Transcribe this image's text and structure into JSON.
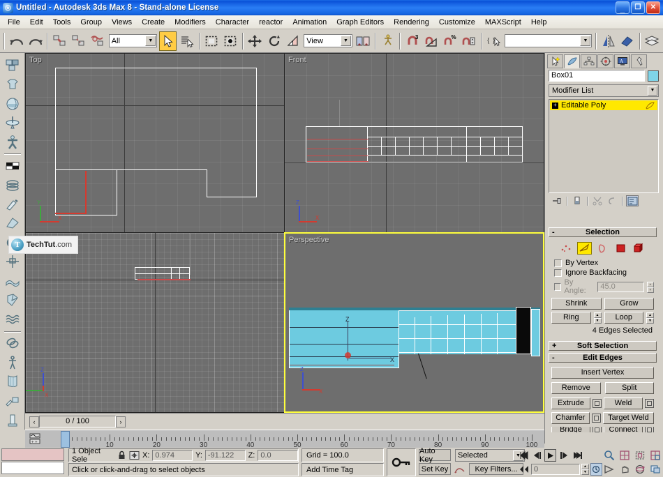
{
  "window": {
    "title": "Untitled - Autodesk 3ds Max 8  - Stand-alone License",
    "app_icon": "3dsmax-icon",
    "minimize_label": "_",
    "restore_label": "❐",
    "close_label": "✕"
  },
  "menubar": {
    "items": [
      {
        "label": "File"
      },
      {
        "label": "Edit"
      },
      {
        "label": "Tools"
      },
      {
        "label": "Group"
      },
      {
        "label": "Views"
      },
      {
        "label": "Create"
      },
      {
        "label": "Modifiers"
      },
      {
        "label": "Character"
      },
      {
        "label": "reactor"
      },
      {
        "label": "Animation"
      },
      {
        "label": "Graph Editors"
      },
      {
        "label": "Rendering"
      },
      {
        "label": "Customize"
      },
      {
        "label": "MAXScript"
      },
      {
        "label": "Help"
      }
    ]
  },
  "toolbar": {
    "undo_icon": "undo-icon",
    "redo_icon": "redo-icon",
    "select_link_icon": "select-and-link-icon",
    "unlink_icon": "unlink-selection-icon",
    "bind_space_warp_icon": "bind-to-space-warp-icon",
    "selection_filter_value": "All",
    "select_object_icon": "select-object-icon",
    "select_by_name_icon": "select-by-name-icon",
    "region_select_icon": "rectangular-selection-region-icon",
    "window_crossing_icon": "window-crossing-icon",
    "select_move_icon": "select-and-move-icon",
    "select_rotate_icon": "select-and-rotate-icon",
    "select_scale_icon": "select-and-uniform-scale-icon",
    "coord_system_value": "View",
    "use_pivot_icon": "use-pivot-point-center-icon",
    "manipulate_icon": "select-and-manipulate-icon",
    "snap_toggle_label": "3",
    "snap_toggle_icon": "snaps-toggle-icon",
    "angle_snap_icon": "angle-snap-toggle-icon",
    "percent_snap_label": "%",
    "percent_snap_icon": "percent-snap-toggle-icon",
    "spinner_snap_icon": "spinner-snap-toggle-icon",
    "named_selection_icon": "named-selection-sets-icon",
    "named_selection_value": "",
    "mirror_icon": "mirror-icon",
    "align_icon": "align-icon",
    "layer_manager_icon": "layer-manager-icon"
  },
  "left_toolbar": {
    "items": [
      {
        "icon": "boxes-icon"
      },
      {
        "icon": "garment-icon"
      },
      {
        "icon": "sphere-icon"
      },
      {
        "icon": "spinning-top-icon"
      },
      {
        "icon": "biped-icon"
      },
      {
        "icon": "checker-icon"
      },
      {
        "icon": "coil-icon"
      },
      {
        "icon": "knife-icon"
      },
      {
        "icon": "wedge-icon"
      },
      {
        "icon": "gear-icon"
      },
      {
        "icon": "compass-icon"
      },
      {
        "icon": "cloth-icon"
      },
      {
        "icon": "fold-icon"
      },
      {
        "icon": "wave-icon"
      },
      {
        "icon": "torus-knot-icon"
      },
      {
        "icon": "skeleton-icon"
      },
      {
        "icon": "curved-surface-icon"
      },
      {
        "icon": "paint-icon"
      },
      {
        "icon": "column-icon"
      }
    ]
  },
  "viewports": [
    {
      "name": "top",
      "label": "Top",
      "active": false
    },
    {
      "name": "front",
      "label": "Front",
      "active": false
    },
    {
      "name": "left",
      "label": "",
      "active": false
    },
    {
      "name": "perspective",
      "label": "Perspective",
      "active": true
    }
  ],
  "viewport_colors": {
    "background": "#6e6e6e",
    "grid_minor": "#7a7a7a",
    "grid_major": "#3c3c3c",
    "wireframe": "#ffffff",
    "selected_edge": "#c84b4b",
    "object_fill": "#6dcbe0",
    "active_border": "#ffff3c",
    "axis_x": "#d43a2f",
    "axis_y": "#3fa83f",
    "axis_z": "#3d4fd0"
  },
  "tripod_labels": {
    "x": "X",
    "y": "Y",
    "z": "Z"
  },
  "command_panel": {
    "tabs": [
      {
        "icon": "create-tab-icon",
        "active": false
      },
      {
        "icon": "modify-tab-icon",
        "active": true
      },
      {
        "icon": "hierarchy-tab-icon",
        "active": false
      },
      {
        "icon": "motion-tab-icon",
        "active": false
      },
      {
        "icon": "display-tab-icon",
        "active": false
      },
      {
        "icon": "utilities-tab-icon",
        "active": false
      }
    ],
    "object_name": "Box01",
    "object_color": "#7fd4e8",
    "modifier_list_label": "Modifier List",
    "stack": [
      {
        "label": "Editable Poly",
        "expand_glyph": "+",
        "highlighted": true
      }
    ],
    "stack_tools": [
      {
        "icon": "pin-stack-icon"
      },
      {
        "icon": "show-end-result-icon"
      },
      {
        "icon": "make-unique-icon"
      },
      {
        "icon": "remove-modifier-icon"
      },
      {
        "icon": "configure-modifier-sets-icon"
      }
    ],
    "rollouts": [
      {
        "name": "selection",
        "title": "Selection",
        "state": "-",
        "subobject_levels": [
          {
            "icon": "vertex-level-icon",
            "active": false
          },
          {
            "icon": "edge-level-icon",
            "active": true
          },
          {
            "icon": "border-level-icon",
            "active": false
          },
          {
            "icon": "polygon-level-icon",
            "active": false
          },
          {
            "icon": "element-level-icon",
            "active": false
          }
        ],
        "checkboxes": [
          {
            "label": "By Vertex",
            "checked": false,
            "disabled": false
          },
          {
            "label": "Ignore Backfacing",
            "checked": false,
            "disabled": false
          },
          {
            "label": "By Angle:",
            "checked": false,
            "disabled": true
          }
        ],
        "by_angle_value": "45.0",
        "buttons": [
          {
            "label": "Shrink"
          },
          {
            "label": "Grow"
          },
          {
            "label": "Ring"
          },
          {
            "label": "Loop"
          }
        ],
        "status_text": "4 Edges Selected"
      },
      {
        "name": "soft-selection",
        "title": "Soft Selection",
        "state": "+"
      },
      {
        "name": "edit-edges",
        "title": "Edit Edges",
        "state": "-",
        "buttons": [
          {
            "label": "Insert Vertex",
            "settings": false,
            "full": true
          },
          {
            "label": "Remove",
            "settings": false
          },
          {
            "label": "Split",
            "settings": false
          },
          {
            "label": "Extrude",
            "settings": true
          },
          {
            "label": "Weld",
            "settings": true
          },
          {
            "label": "Chamfer",
            "settings": true
          },
          {
            "label": "Target Weld",
            "settings": false
          },
          {
            "label": "Bridge",
            "settings": true
          },
          {
            "label": "Connect",
            "settings": true
          }
        ]
      }
    ]
  },
  "trackbar": {
    "prev_label": "‹",
    "next_label": "›",
    "frame_display": "0 / 100",
    "ruler_labels": [
      "10",
      "20",
      "30",
      "40",
      "50",
      "60",
      "70",
      "80",
      "90",
      "100"
    ],
    "ruler_min": 0,
    "ruler_max": 100,
    "current_frame": 0,
    "track_view_icon": "mini-curve-editor-icon"
  },
  "statusbar": {
    "selection_text": "1 Object Sele",
    "lock_icon": "selection-lock-icon",
    "transform_icon": "absolute-relative-transform-icon",
    "x_label": "X:",
    "x_value": "0.974",
    "y_label": "Y:",
    "y_value": "-91.122",
    "z_label": "Z:",
    "z_value": "0.0",
    "grid_text": "Grid = 100.0",
    "prompt_text": "Click or click-and-drag to select objects",
    "time_tag_text": "Add Time Tag",
    "key_mode_icon": "key-mode-toggle-icon",
    "auto_key_label": "Auto Key",
    "set_key_label": "Set Key",
    "key_filters_label": "Key Filters...",
    "selection_set_value": "Selected",
    "set_key_curve_icon": "set-key-curve-icon",
    "current_frame_value": "0",
    "playback": [
      {
        "icon": "goto-start-icon",
        "glyph": "⏮"
      },
      {
        "icon": "previous-frame-icon",
        "glyph": "⏴|"
      },
      {
        "icon": "play-animation-icon",
        "glyph": "▶"
      },
      {
        "icon": "next-frame-icon",
        "glyph": "|⏵"
      },
      {
        "icon": "goto-end-icon",
        "glyph": "⏭"
      }
    ],
    "nav_buttons": [
      {
        "icon": "zoom-icon"
      },
      {
        "icon": "zoom-all-icon"
      },
      {
        "icon": "zoom-extents-icon"
      },
      {
        "icon": "zoom-region-icon"
      },
      {
        "icon": "field-of-view-icon"
      },
      {
        "icon": "pan-icon"
      },
      {
        "icon": "arc-rotate-icon"
      },
      {
        "icon": "maximize-viewport-toggle-icon"
      }
    ],
    "key_timeline_icon": "key-timeline-icon"
  },
  "watermark": {
    "logo": "techtut-logo",
    "logo_letter": "T",
    "name": "TechTut",
    "suffix": ".com"
  }
}
